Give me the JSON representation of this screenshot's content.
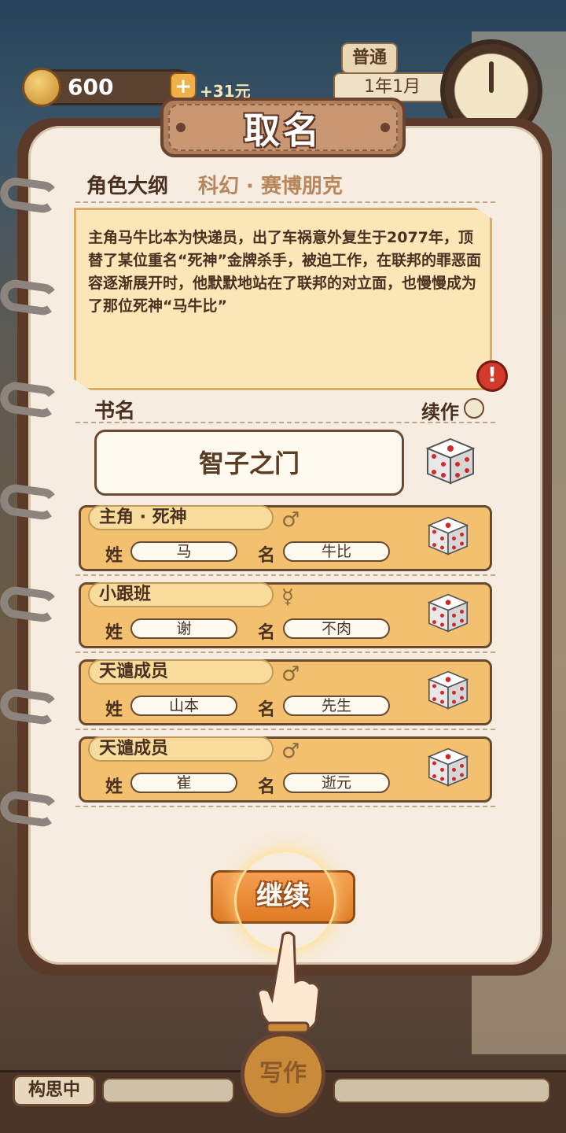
{
  "hud": {
    "coins": "600",
    "plus": "+",
    "income": "+31元",
    "difficulty": "普通",
    "date": "1年1月"
  },
  "dialog": {
    "title": "取名",
    "outline_label": "角色大纲",
    "genre": "科幻 · 赛博朋克",
    "synopsis": "主角马牛比本为快递员，出了车祸意外复生于2077年，顶替了某位重名“死神”金牌杀手，被迫工作，在联邦的罪恶面容逐渐展开时，他默默地站在了联邦的对立面，也慢慢成为了那位死神“马牛比”",
    "warning_icon": "!",
    "bookname_label": "书名",
    "sequel_label": "续作",
    "bookname": "智子之门",
    "surname_label": "姓",
    "givenname_label": "名",
    "characters": [
      {
        "role": "主角 · 死神",
        "gender": "♂",
        "surname": "马",
        "givenname": "牛比"
      },
      {
        "role": "小跟班",
        "gender": "☿",
        "surname": "谢",
        "givenname": "不肉"
      },
      {
        "role": "天谴成员",
        "gender": "♂",
        "surname": "山本",
        "givenname": "先生"
      },
      {
        "role": "天谴成员",
        "gender": "♂",
        "surname": "崔",
        "givenname": "逝元"
      }
    ],
    "continue_label": "继续"
  },
  "bottom": {
    "thinking_label": "构思中",
    "write_label": "写作"
  },
  "colors": {
    "page_bg": "#f6ece0",
    "card_bg": "#f2c06e",
    "accent_orange": "#e07a24",
    "border_brown": "#6a4a30"
  }
}
